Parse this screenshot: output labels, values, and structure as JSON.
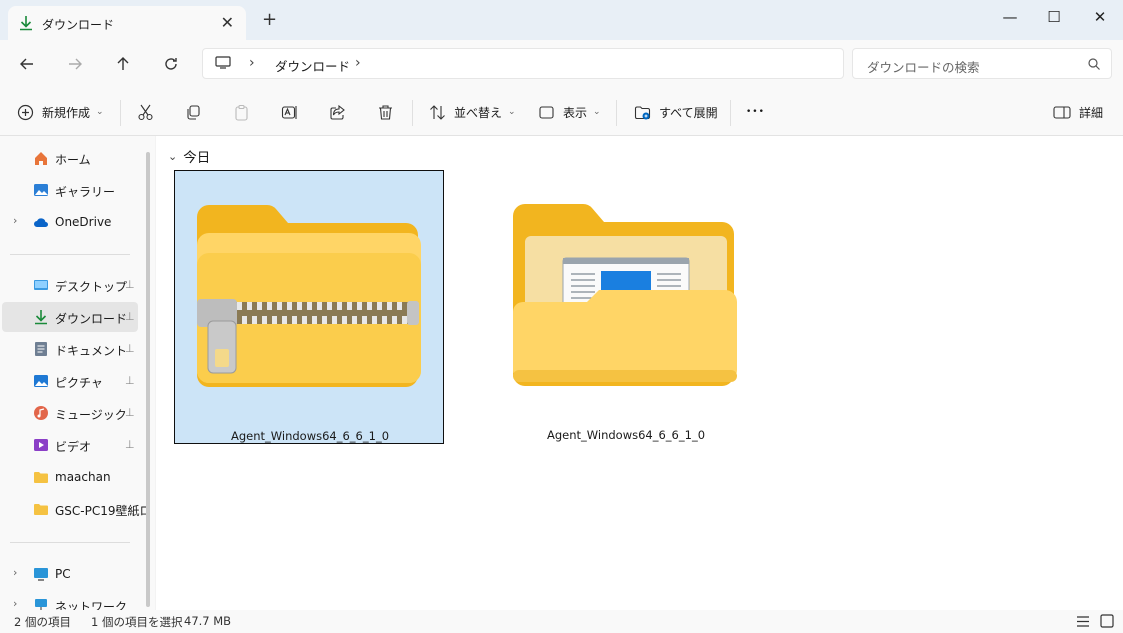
{
  "window": {
    "tab_title": "ダウンロード",
    "tab_close": "✕",
    "new_tab": "+",
    "minimize": "—",
    "maximize": "☐",
    "close": "✕"
  },
  "nav": {
    "back_icon": "arrow-left-icon",
    "forward_icon": "arrow-right-icon",
    "up_icon": "arrow-up-icon",
    "refresh_icon": "refresh-icon",
    "breadcrumb_sep": "›",
    "breadcrumb": [
      "ダウンロード"
    ],
    "search_placeholder": "ダウンロードの検索"
  },
  "toolbar": {
    "new_label": "新規作成",
    "sort_label": "並べ替え",
    "view_label": "表示",
    "expand_all_label": "すべて展開",
    "more_label": "•••",
    "details_label": "詳細",
    "dropdown_glyph": "⌄"
  },
  "sidebar": {
    "items": [
      {
        "label": "ホーム"
      },
      {
        "label": "ギャラリー"
      },
      {
        "label": "OneDrive"
      },
      {
        "label": "デスクトップ"
      },
      {
        "label": "ダウンロード"
      },
      {
        "label": "ドキュメント"
      },
      {
        "label": "ピクチャ"
      },
      {
        "label": "ミュージック"
      },
      {
        "label": "ビデオ"
      },
      {
        "label": "maachan"
      },
      {
        "label": "GSC-PC19壁紙ロ"
      },
      {
        "label": "PC"
      },
      {
        "label": "ネットワーク"
      }
    ],
    "expand_glyph": "›",
    "pin_glyph": "📌"
  },
  "content": {
    "group_label": "今日",
    "group_glyph": "⌄",
    "files": [
      {
        "name": "Agent_Windows64_6_6_1_0",
        "type": "zip",
        "selected": true
      },
      {
        "name": "Agent_Windows64_6_6_1_0",
        "type": "folder",
        "selected": false
      }
    ]
  },
  "status": {
    "item_count": "2 個の項目",
    "selected": "1 個の項目を選択",
    "size": "47.7 MB"
  },
  "colors": {
    "accent": "#0067c0",
    "selection": "#cce4f7",
    "folder_yellow": "#f8c94a"
  }
}
